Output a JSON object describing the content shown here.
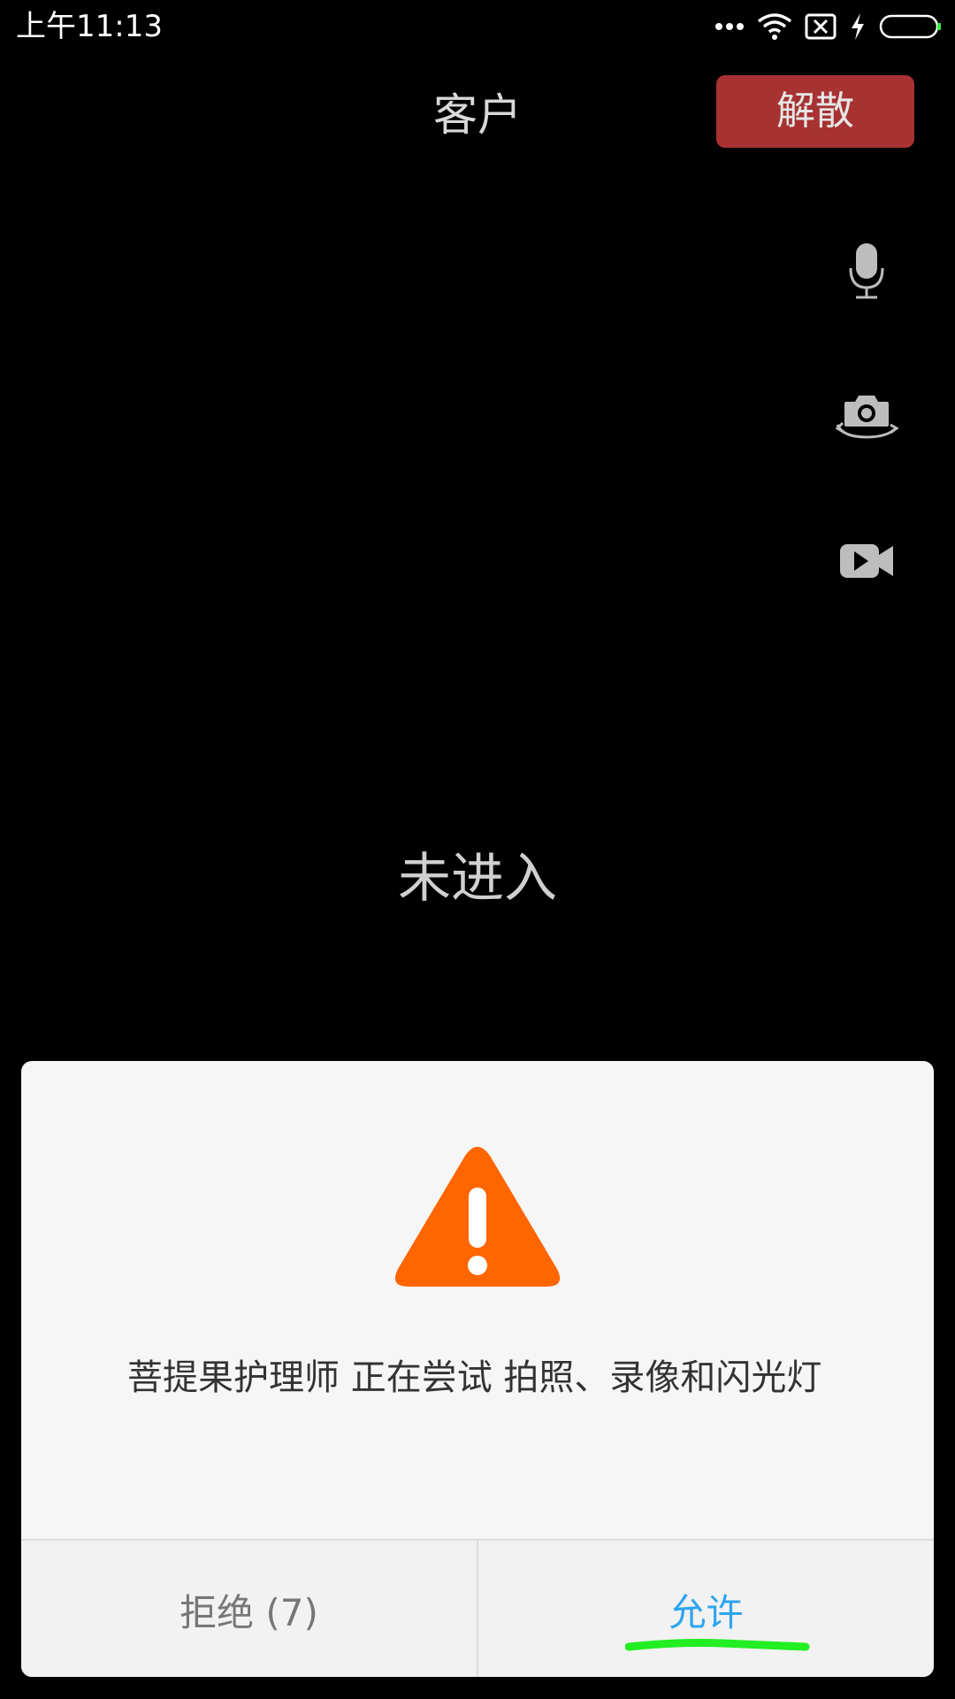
{
  "status_bar": {
    "time": "上午11:13",
    "icons": [
      "more-icon",
      "wifi-icon",
      "sim-off-icon",
      "charging-icon",
      "battery-icon"
    ]
  },
  "header": {
    "title": "客户",
    "dismiss_label": "解散"
  },
  "side_controls": [
    "microphone-icon",
    "switch-camera-icon",
    "video-camera-icon"
  ],
  "main": {
    "status_text": "未进入"
  },
  "dialog": {
    "icon": "warning-icon",
    "message": "菩提果护理师 正在尝试 拍照、录像和闪光灯",
    "deny_label": "拒绝 (7)",
    "allow_label": "允许"
  },
  "colors": {
    "background": "#000000",
    "dismiss_button": "#a83232",
    "warning": "#ff6600",
    "allow_text": "#2da5f0",
    "annotation": "#22ee22"
  }
}
